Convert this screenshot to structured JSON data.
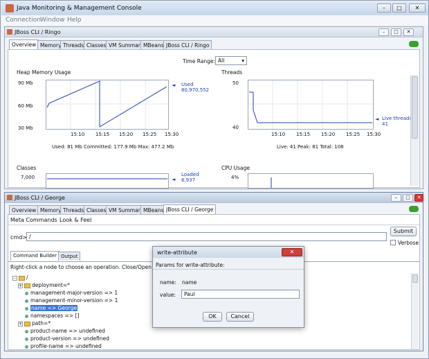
{
  "window": {
    "title": "Java Monitoring & Management Console"
  },
  "menu": [
    "Connection",
    "Window",
    "Help"
  ],
  "ringo": {
    "title": "JBoss CLI / Ringo",
    "tabs": [
      "Overview",
      "Memory",
      "Threads",
      "Classes",
      "VM Summary",
      "MBeans",
      "JBoss CLI / Ringo"
    ],
    "time_range_label": "Time Range:",
    "time_range_value": "All",
    "heap": {
      "title": "Heap Memory Usage",
      "yticks": [
        "90 Mb",
        "60 Mb",
        "30 Mb"
      ],
      "xticks": [
        "15:10",
        "15:15",
        "15:20",
        "15:25",
        "15:30"
      ],
      "legend_label": "Used",
      "legend_value": "80,970,552",
      "stats": "Used: 81 Mb    Committed: 177.9 Mb    Max: 477.2 Mb"
    },
    "threads": {
      "title": "Threads",
      "yticks": [
        "50",
        "40"
      ],
      "xticks": [
        "15:10",
        "15:15",
        "15:20",
        "15:25",
        "15:30"
      ],
      "legend_label": "Live threads",
      "legend_value": "41",
      "stats": "Live: 41    Peak: 81    Total: 108"
    },
    "classes": {
      "title": "Classes",
      "ytick": "7,000",
      "legend_label": "Loaded",
      "legend_value": "6,937"
    },
    "cpu": {
      "title": "CPU Usage",
      "ytick": "4%"
    }
  },
  "george": {
    "title": "JBoss CLI / George",
    "tabs": [
      "Overview",
      "Memory",
      "Threads",
      "Classes",
      "VM Summary",
      "MBeans",
      "JBoss CLI / George"
    ],
    "menu": [
      "Meta Commands",
      "Look & Feel"
    ],
    "cmd_label": "cmd>",
    "cmd_value": "/",
    "submit_label": "Submit",
    "verbose_label": "Verbose",
    "subtabs": [
      "Command Builder",
      "Output"
    ],
    "hint": "Right-click a node to choose an operation.  Close/Open a fold",
    "tree": [
      {
        "label": "/",
        "type": "root"
      },
      {
        "label": "deployment=*",
        "type": "folder"
      },
      {
        "label": "management-major-version => 1",
        "type": "leaf"
      },
      {
        "label": "management-minor-version => 1",
        "type": "leaf"
      },
      {
        "label": "name => George",
        "type": "leaf",
        "selected": true
      },
      {
        "label": "namespaces => []",
        "type": "leaf"
      },
      {
        "label": "path=*",
        "type": "folder"
      },
      {
        "label": "product-name => undefined",
        "type": "leaf"
      },
      {
        "label": "product-version => undefined",
        "type": "leaf"
      },
      {
        "label": "profile-name => undefined",
        "type": "leaf"
      }
    ]
  },
  "dialog": {
    "title": "write-attribute",
    "subtitle": "Params for write-attribute:",
    "name_label": "name:",
    "name_value": "name",
    "value_label": "value:",
    "value_value": "Paul",
    "ok_label": "OK",
    "cancel_label": "Cancel"
  },
  "colors": {
    "accent": "#3b78d4",
    "plot_line": "#1a3fb5",
    "status_green": "#3aa02e"
  }
}
